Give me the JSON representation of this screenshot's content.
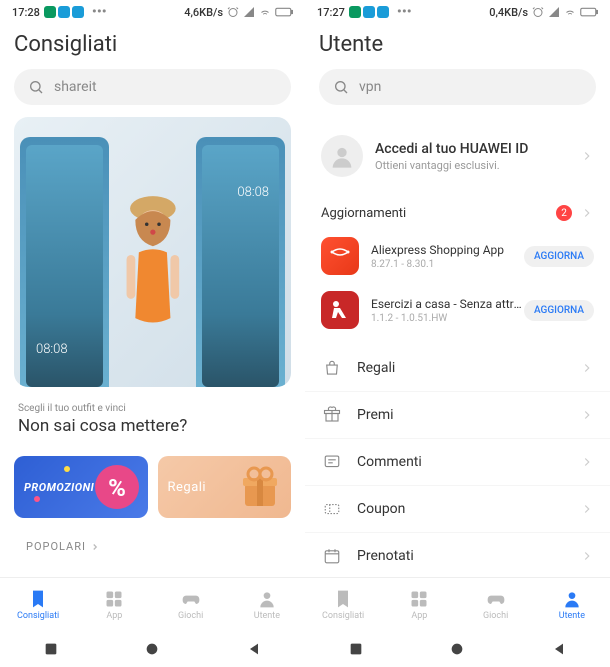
{
  "left": {
    "status": {
      "time": "17:28",
      "speed": "4,6KB/s"
    },
    "title": "Consigliati",
    "search": {
      "placeholder": "shareit"
    },
    "hero": {
      "subtitle": "Scegli il tuo outfit e vinci",
      "title": "Non sai cosa mettere?",
      "phone_time": "08:08"
    },
    "promos": {
      "p1": "PROMOZIONI",
      "p2": "Regali"
    },
    "popolari": "POPOLARI",
    "nav": [
      "Consigliati",
      "App",
      "Giochi",
      "Utente"
    ]
  },
  "right": {
    "status": {
      "time": "17:27",
      "speed": "0,4KB/s"
    },
    "title": "Utente",
    "search": {
      "placeholder": "vpn"
    },
    "account": {
      "title": "Accedi al tuo HUAWEI ID",
      "subtitle": "Ottieni vantaggi esclusivi."
    },
    "updates": {
      "header": "Aggiornamenti",
      "badge": "2",
      "btn": "AGGIORNA",
      "apps": [
        {
          "name": "Aliexpress Shopping App",
          "version": "8.27.1 - 8.30.1"
        },
        {
          "name": "Esercizi a casa - Senza attrezzature",
          "version": "1.1.2 - 1.0.51.HW"
        }
      ]
    },
    "menu": [
      "Regali",
      "Premi",
      "Commenti",
      "Coupon",
      "Prenotati"
    ],
    "nav": [
      "Consigliati",
      "App",
      "Giochi",
      "Utente"
    ]
  }
}
